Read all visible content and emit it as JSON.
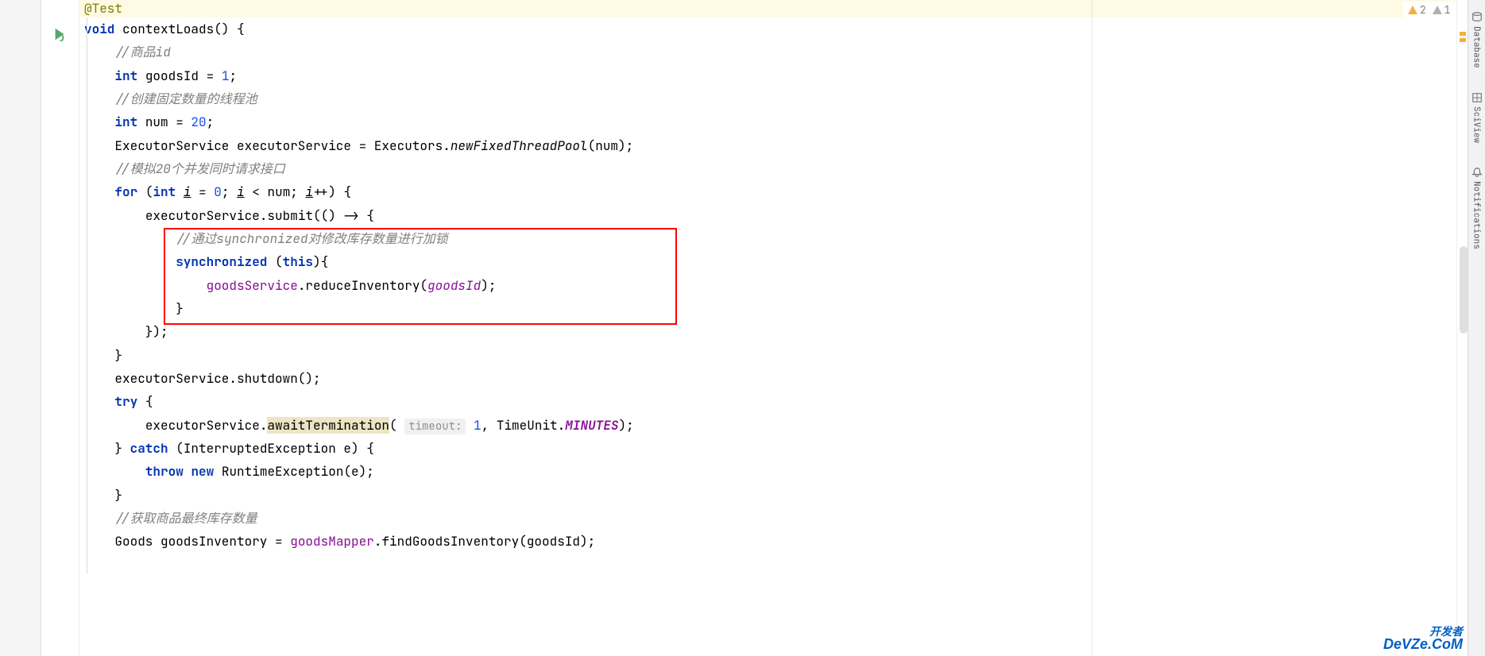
{
  "inspections": {
    "warnings": "2",
    "weak_warnings": "1"
  },
  "side_tools": {
    "database": "Database",
    "sciview": "SciView",
    "notifications": "Notifications"
  },
  "watermark": {
    "cn": "开发者",
    "en": "DeVZe.CoM"
  },
  "code": {
    "l1": {
      "annotation": "@Test"
    },
    "l2": {
      "kw_void": "void",
      "name": " contextLoads() {"
    },
    "l3": {
      "comment": "//商品id"
    },
    "l4": {
      "kw_int": "int",
      "rest": " goodsId = ",
      "num": "1",
      "semi": ";"
    },
    "l5": {
      "comment": "//创建固定数量的线程池"
    },
    "l6": {
      "kw_int": "int",
      "rest": " num = ",
      "num": "20",
      "semi": ";"
    },
    "l7": {
      "p1": "ExecutorService executorService = Executors.",
      "method": "newFixedThreadPool",
      "p2": "(num);"
    },
    "l8": {
      "comment": "//模拟20个并发同时请求接口"
    },
    "l9": {
      "kw_for": "for",
      "p1": " (",
      "kw_int": "int",
      "p2": " ",
      "var_i": "i",
      "p3": " = ",
      "num": "0",
      "p4": "; ",
      "var_i2": "i",
      "p5": " < num; ",
      "var_i3": "i",
      "p6": "++) {"
    },
    "l10": {
      "text": "executorService.submit(() -> {"
    },
    "l11": {
      "c1": "//通过",
      "c2": "synchronized",
      "c3": "对修改库存数量进行加锁"
    },
    "l12": {
      "kw_sync": "synchronized",
      "p1": " (",
      "kw_this": "this",
      "p2": "){"
    },
    "l13": {
      "svc": "goodsService",
      "p1": ".reduceInventory(",
      "var": "goodsId",
      "p2": ");"
    },
    "l14": {
      "text": "}"
    },
    "l15": {
      "text": "});"
    },
    "l16": {
      "text": "}"
    },
    "l17": {
      "text": "executorService.shutdown();"
    },
    "l18": {
      "kw_try": "try",
      "rest": " {"
    },
    "l19": {
      "p1": "executorService.",
      "hl": "awaitTermination",
      "p2": "( ",
      "hint": "timeout:",
      "sp": " ",
      "num": "1",
      "p3": ", TimeUnit.",
      "unit": "MINUTES",
      "p4": ");"
    },
    "l20": {
      "p1": "} ",
      "kw_catch": "catch",
      "p2": " (InterruptedException e) {"
    },
    "l21": {
      "kw_throw": "throw",
      "sp": " ",
      "kw_new": "new",
      "rest": " RuntimeException(e);"
    },
    "l22": {
      "text": "}"
    },
    "l23": {
      "comment": "//获取商品最终库存数量"
    },
    "l24": {
      "p1": "Goods goodsInventory = ",
      "mapper": "goodsMapper",
      "p2": ".findGoodsInventory(goodsId);"
    }
  }
}
